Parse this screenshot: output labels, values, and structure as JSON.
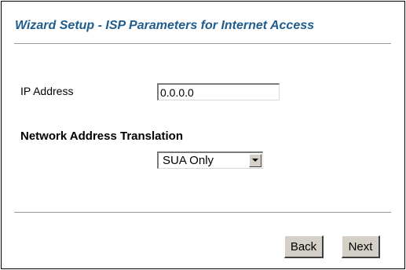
{
  "header": {
    "title": "Wizard Setup - ISP Parameters for Internet Access"
  },
  "fields": {
    "ip_address_label": "IP Address",
    "ip_address_value": "0.0.0.0",
    "nat_label": "Network Address Translation",
    "nat_selected": "SUA Only"
  },
  "icons": {
    "dropdown_arrow": "chevron-down-icon"
  },
  "buttons": {
    "back_label": "Back",
    "next_label": "Next"
  },
  "colors": {
    "title": "#1f5d8f",
    "button_face": "#d4d0c8"
  }
}
